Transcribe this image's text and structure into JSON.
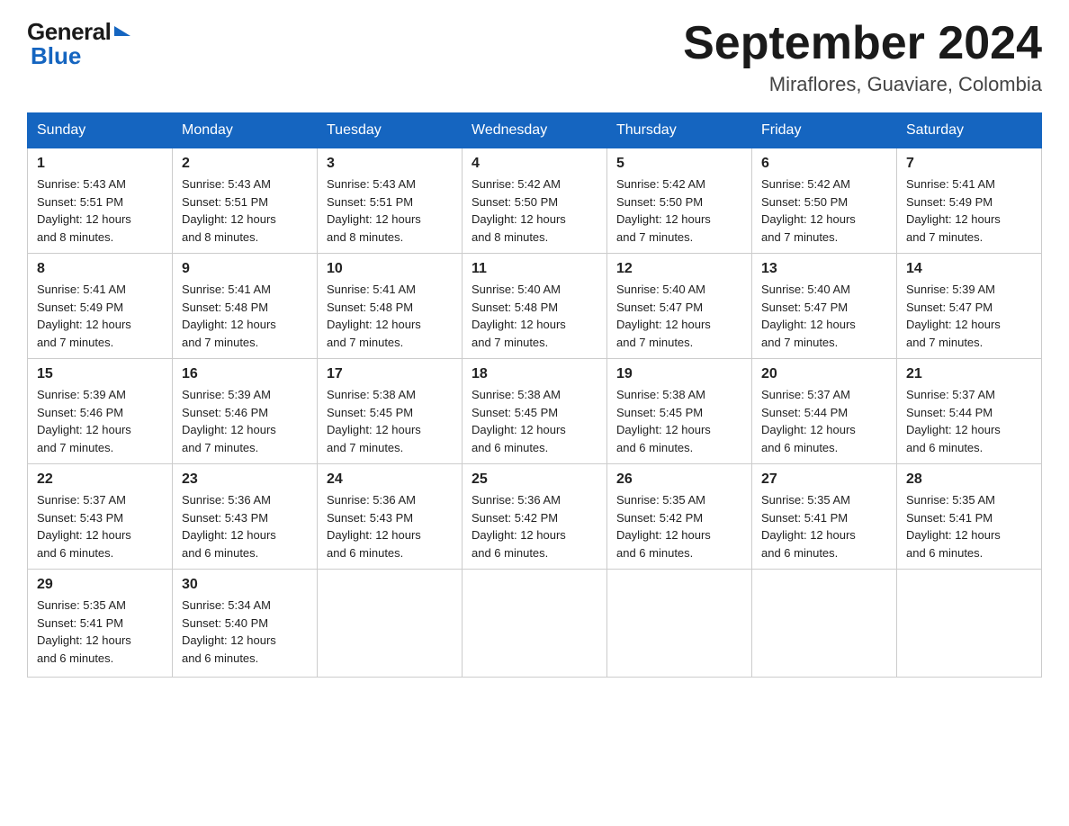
{
  "header": {
    "logo_general": "General",
    "logo_blue": "Blue",
    "month_title": "September 2024",
    "location": "Miraflores, Guaviare, Colombia"
  },
  "weekdays": [
    "Sunday",
    "Monday",
    "Tuesday",
    "Wednesday",
    "Thursday",
    "Friday",
    "Saturday"
  ],
  "weeks": [
    [
      {
        "day": "1",
        "sunrise": "5:43 AM",
        "sunset": "5:51 PM",
        "daylight": "12 hours and 8 minutes."
      },
      {
        "day": "2",
        "sunrise": "5:43 AM",
        "sunset": "5:51 PM",
        "daylight": "12 hours and 8 minutes."
      },
      {
        "day": "3",
        "sunrise": "5:43 AM",
        "sunset": "5:51 PM",
        "daylight": "12 hours and 8 minutes."
      },
      {
        "day": "4",
        "sunrise": "5:42 AM",
        "sunset": "5:50 PM",
        "daylight": "12 hours and 8 minutes."
      },
      {
        "day": "5",
        "sunrise": "5:42 AM",
        "sunset": "5:50 PM",
        "daylight": "12 hours and 7 minutes."
      },
      {
        "day": "6",
        "sunrise": "5:42 AM",
        "sunset": "5:50 PM",
        "daylight": "12 hours and 7 minutes."
      },
      {
        "day": "7",
        "sunrise": "5:41 AM",
        "sunset": "5:49 PM",
        "daylight": "12 hours and 7 minutes."
      }
    ],
    [
      {
        "day": "8",
        "sunrise": "5:41 AM",
        "sunset": "5:49 PM",
        "daylight": "12 hours and 7 minutes."
      },
      {
        "day": "9",
        "sunrise": "5:41 AM",
        "sunset": "5:48 PM",
        "daylight": "12 hours and 7 minutes."
      },
      {
        "day": "10",
        "sunrise": "5:41 AM",
        "sunset": "5:48 PM",
        "daylight": "12 hours and 7 minutes."
      },
      {
        "day": "11",
        "sunrise": "5:40 AM",
        "sunset": "5:48 PM",
        "daylight": "12 hours and 7 minutes."
      },
      {
        "day": "12",
        "sunrise": "5:40 AM",
        "sunset": "5:47 PM",
        "daylight": "12 hours and 7 minutes."
      },
      {
        "day": "13",
        "sunrise": "5:40 AM",
        "sunset": "5:47 PM",
        "daylight": "12 hours and 7 minutes."
      },
      {
        "day": "14",
        "sunrise": "5:39 AM",
        "sunset": "5:47 PM",
        "daylight": "12 hours and 7 minutes."
      }
    ],
    [
      {
        "day": "15",
        "sunrise": "5:39 AM",
        "sunset": "5:46 PM",
        "daylight": "12 hours and 7 minutes."
      },
      {
        "day": "16",
        "sunrise": "5:39 AM",
        "sunset": "5:46 PM",
        "daylight": "12 hours and 7 minutes."
      },
      {
        "day": "17",
        "sunrise": "5:38 AM",
        "sunset": "5:45 PM",
        "daylight": "12 hours and 7 minutes."
      },
      {
        "day": "18",
        "sunrise": "5:38 AM",
        "sunset": "5:45 PM",
        "daylight": "12 hours and 6 minutes."
      },
      {
        "day": "19",
        "sunrise": "5:38 AM",
        "sunset": "5:45 PM",
        "daylight": "12 hours and 6 minutes."
      },
      {
        "day": "20",
        "sunrise": "5:37 AM",
        "sunset": "5:44 PM",
        "daylight": "12 hours and 6 minutes."
      },
      {
        "day": "21",
        "sunrise": "5:37 AM",
        "sunset": "5:44 PM",
        "daylight": "12 hours and 6 minutes."
      }
    ],
    [
      {
        "day": "22",
        "sunrise": "5:37 AM",
        "sunset": "5:43 PM",
        "daylight": "12 hours and 6 minutes."
      },
      {
        "day": "23",
        "sunrise": "5:36 AM",
        "sunset": "5:43 PM",
        "daylight": "12 hours and 6 minutes."
      },
      {
        "day": "24",
        "sunrise": "5:36 AM",
        "sunset": "5:43 PM",
        "daylight": "12 hours and 6 minutes."
      },
      {
        "day": "25",
        "sunrise": "5:36 AM",
        "sunset": "5:42 PM",
        "daylight": "12 hours and 6 minutes."
      },
      {
        "day": "26",
        "sunrise": "5:35 AM",
        "sunset": "5:42 PM",
        "daylight": "12 hours and 6 minutes."
      },
      {
        "day": "27",
        "sunrise": "5:35 AM",
        "sunset": "5:41 PM",
        "daylight": "12 hours and 6 minutes."
      },
      {
        "day": "28",
        "sunrise": "5:35 AM",
        "sunset": "5:41 PM",
        "daylight": "12 hours and 6 minutes."
      }
    ],
    [
      {
        "day": "29",
        "sunrise": "5:35 AM",
        "sunset": "5:41 PM",
        "daylight": "12 hours and 6 minutes."
      },
      {
        "day": "30",
        "sunrise": "5:34 AM",
        "sunset": "5:40 PM",
        "daylight": "12 hours and 6 minutes."
      },
      null,
      null,
      null,
      null,
      null
    ]
  ],
  "labels": {
    "sunrise": "Sunrise:",
    "sunset": "Sunset:",
    "daylight": "Daylight:"
  }
}
